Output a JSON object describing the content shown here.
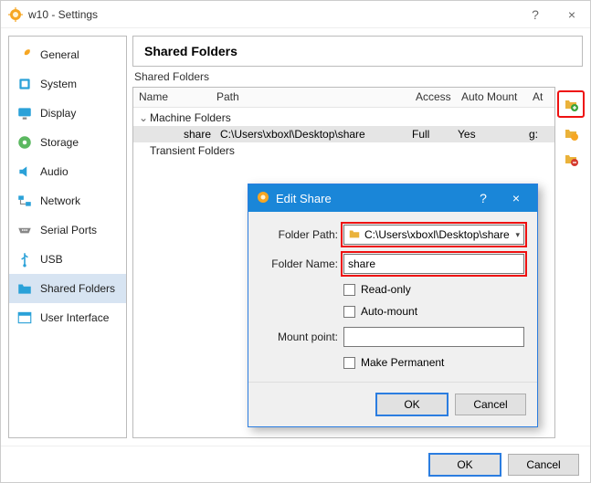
{
  "window": {
    "title": "w10 - Settings",
    "help_btn": "?",
    "close_btn": "×"
  },
  "sidebar": {
    "items": [
      {
        "label": "General"
      },
      {
        "label": "System"
      },
      {
        "label": "Display"
      },
      {
        "label": "Storage"
      },
      {
        "label": "Audio"
      },
      {
        "label": "Network"
      },
      {
        "label": "Serial Ports"
      },
      {
        "label": "USB"
      },
      {
        "label": "Shared Folders"
      },
      {
        "label": "User Interface"
      }
    ],
    "active_index": 8
  },
  "main": {
    "heading": "Shared Folders",
    "section_label": "Shared Folders",
    "columns": {
      "name": "Name",
      "path": "Path",
      "access": "Access",
      "auto": "Auto Mount",
      "at": "At"
    },
    "groups": {
      "machine": "Machine Folders",
      "transient": "Transient Folders"
    },
    "row": {
      "name": "share",
      "path": "C:\\Users\\xboxl\\Desktop\\share",
      "access": "Full",
      "auto": "Yes",
      "at": "g:"
    }
  },
  "dialog": {
    "title": "Edit Share",
    "help_btn": "?",
    "close_btn": "×",
    "labels": {
      "folder_path": "Folder Path:",
      "folder_name": "Folder Name:",
      "mount_point": "Mount point:"
    },
    "values": {
      "folder_path": "C:\\Users\\xboxl\\Desktop\\share",
      "folder_name": "share",
      "mount_point": ""
    },
    "checks": {
      "read_only": "Read-only",
      "auto_mount": "Auto-mount",
      "permanent": "Make Permanent"
    },
    "ok": "OK",
    "cancel": "Cancel"
  },
  "footer": {
    "ok": "OK",
    "cancel": "Cancel"
  }
}
